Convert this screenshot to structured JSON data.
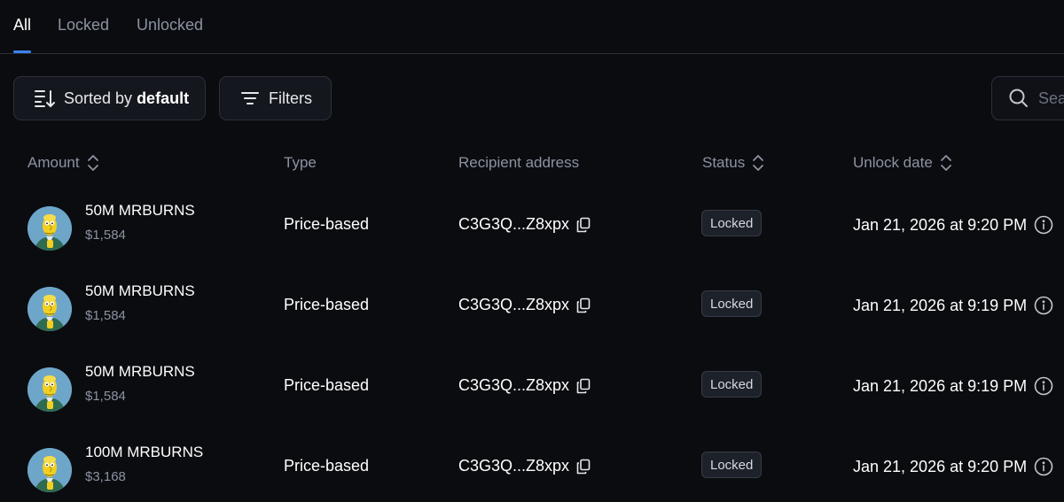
{
  "tabs": [
    {
      "label": "All",
      "active": true
    },
    {
      "label": "Locked",
      "active": false
    },
    {
      "label": "Unlocked",
      "active": false
    }
  ],
  "toolbar": {
    "sort_prefix": "Sorted by",
    "sort_value": "default",
    "filters_label": "Filters",
    "search_placeholder": "Search"
  },
  "table": {
    "columns": [
      "Amount",
      "Type",
      "Recipient address",
      "Status",
      "Unlock date"
    ],
    "rows": [
      {
        "amount": "50M MRBURNS",
        "usd": "$1,584",
        "type": "Price-based",
        "recipient": "C3G3Q...Z8xpx",
        "status": "Locked",
        "unlock_date": "Jan 21, 2026 at 9:20 PM"
      },
      {
        "amount": "50M MRBURNS",
        "usd": "$1,584",
        "type": "Price-based",
        "recipient": "C3G3Q...Z8xpx",
        "status": "Locked",
        "unlock_date": "Jan 21, 2026 at 9:19 PM"
      },
      {
        "amount": "50M MRBURNS",
        "usd": "$1,584",
        "type": "Price-based",
        "recipient": "C3G3Q...Z8xpx",
        "status": "Locked",
        "unlock_date": "Jan 21, 2026 at 9:19 PM"
      },
      {
        "amount": "100M MRBURNS",
        "usd": "$3,168",
        "type": "Price-based",
        "recipient": "C3G3Q...Z8xpx",
        "status": "Locked",
        "unlock_date": "Jan 21, 2026 at 9:20 PM"
      }
    ]
  },
  "icons": {
    "sort": "sort-icon",
    "filter": "filter-icon",
    "search": "search-icon",
    "column_sort": "chevron-up-down-icon",
    "copy": "copy-icon",
    "info": "info-icon",
    "token_avatar": "token-avatar-icon"
  },
  "colors": {
    "background": "#0b0c10",
    "accent": "#3b82f6",
    "muted_text": "#8b93a1",
    "badge_bg": "#1d2129"
  }
}
